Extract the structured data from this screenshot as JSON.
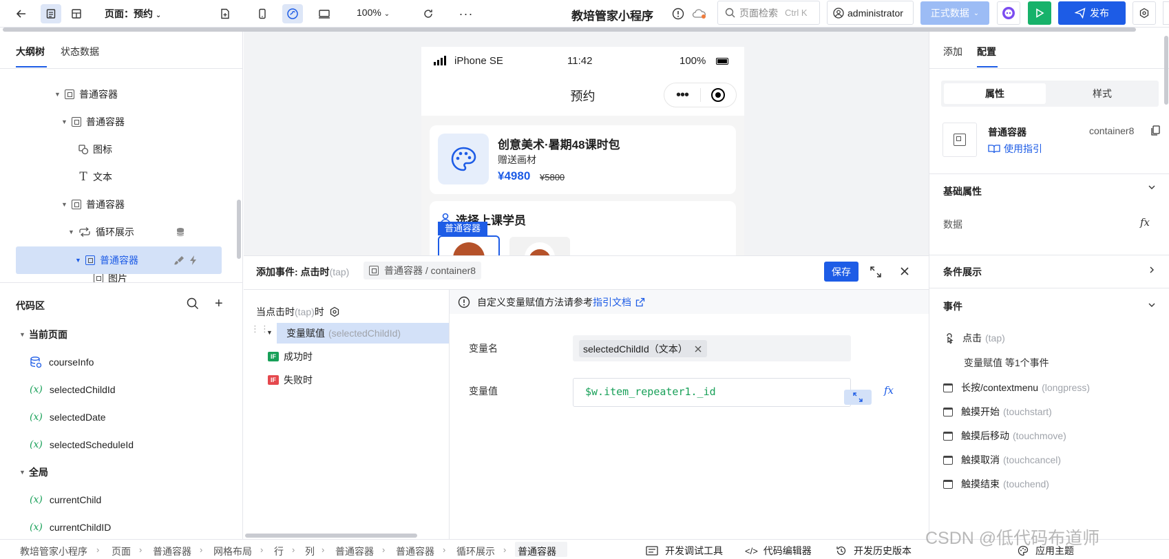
{
  "toolbar": {
    "page_label": "页面：预约",
    "zoom": "100%",
    "app_title": "教培管家小程序",
    "search_placeholder": "页面检索",
    "search_shortcut": "Ctrl K",
    "user": "administrator",
    "data_env": "正式数据",
    "publish": "发布"
  },
  "left": {
    "tabs": [
      "大纲树",
      "状态数据"
    ],
    "tree": [
      {
        "label": "普通容器",
        "icon": "container-icon"
      },
      {
        "label": "普通容器",
        "icon": "container-icon"
      },
      {
        "label": "图标",
        "icon": "icon-component-icon"
      },
      {
        "label": "文本",
        "icon": "text-icon"
      },
      {
        "label": "普通容器",
        "icon": "container-icon"
      },
      {
        "label": "循环展示",
        "icon": "loop-icon"
      },
      {
        "label": "普通容器",
        "icon": "container-icon"
      },
      {
        "label": "图片",
        "icon": "image-icon"
      }
    ],
    "code_area_title": "代码区",
    "current_page": "当前页面",
    "page_vars": [
      "courseInfo",
      "selectedChildId",
      "selectedDate",
      "selectedScheduleId"
    ],
    "global": "全局",
    "global_vars": [
      "currentChild",
      "currentChildID"
    ]
  },
  "phone": {
    "device": "iPhone SE",
    "time": "11:42",
    "battery": "100%",
    "nav_title": "预约",
    "course_title": "创意美术·暑期48课时包",
    "course_gift": "赠送画材",
    "price": "¥4980",
    "orig_price": "¥5800",
    "student_title": "选择上课学员",
    "selected_tag": "普通容器"
  },
  "event_panel": {
    "title": "添加事件: 点击时",
    "title_suffix": "(tap)",
    "target": "普通容器 / container8",
    "save": "保存",
    "trigger": "当点击时",
    "trigger_tap": "(tap)",
    "trigger_suffix": "时",
    "action": "变量赋值",
    "action_var": "(selectedChildId)",
    "success": "成功时",
    "fail": "失败时",
    "hint": "自定义变量赋值方法请参考",
    "hint_link": "指引文档",
    "var_name_label": "变量名",
    "var_name_tag": "selectedChildId（文本）",
    "var_value_label": "变量值",
    "var_value": "$w.item_repeater1._id"
  },
  "right": {
    "tabs": [
      "添加",
      "配置"
    ],
    "seg": [
      "属性",
      "样式"
    ],
    "component_name": "普通容器",
    "component_id": "container8",
    "guide": "使用指引",
    "basic_props": "基础属性",
    "data_label": "数据",
    "condition": "条件展示",
    "events_title": "事件",
    "events": [
      {
        "name": "点击",
        "code": "(tap)"
      },
      {
        "name": "长按/contextmenu",
        "code": "(longpress)"
      },
      {
        "name": "触摸开始",
        "code": "(touchstart)"
      },
      {
        "name": "触摸后移动",
        "code": "(touchmove)"
      },
      {
        "name": "触摸取消",
        "code": "(touchcancel)"
      },
      {
        "name": "触摸结束",
        "code": "(touchend)"
      }
    ],
    "tap_sub": "变量赋值 等1个事件"
  },
  "bottom": {
    "crumbs": [
      "教培管家小程序",
      "页面",
      "普通容器",
      "网格布局",
      "行",
      "列",
      "普通容器",
      "普通容器",
      "循环展示",
      "普通容器"
    ],
    "debug": "开发调试工具",
    "code_editor": "代码编辑器",
    "history": "开发历史版本",
    "theme": "应用主题",
    "watermark": "CSDN @低代码布道师"
  },
  "colors": {
    "primary": "#1d5ce6",
    "green": "#18a058",
    "light_blue": "#dde6f7"
  }
}
